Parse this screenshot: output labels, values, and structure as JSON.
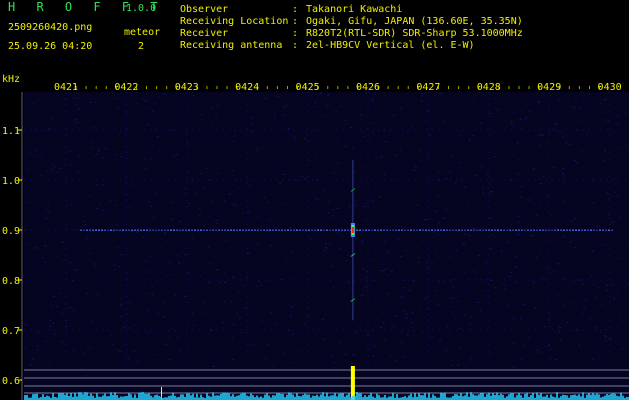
{
  "app": {
    "logo": "H R O F F T",
    "version": "1.0.0",
    "filename": "2509260420.png",
    "datetime": "25.09.26 04:20",
    "mode_label": "meteor",
    "count": "2"
  },
  "info": [
    {
      "label": "Observer",
      "sep": ":",
      "value": "Takanori Kawachi"
    },
    {
      "label": "Receiving Location",
      "sep": ":",
      "value": "Ogaki, Gifu, JAPAN (136.60E, 35.35N)"
    },
    {
      "label": "Receiver",
      "sep": ":",
      "value": "R820T2(RTL-SDR) SDR-Sharp 53.1000MHz"
    },
    {
      "label": "Receiving antenna",
      "sep": ":",
      "value": "2el-HB9CV Vertical (el. E-W)"
    }
  ],
  "chart_data": {
    "type": "heatmap",
    "ylabel": "kHz",
    "x_ticks": [
      "0421",
      "0422",
      "0423",
      "0424",
      "0425",
      "0426",
      "0427",
      "0428",
      "0429",
      "0430"
    ],
    "y_ticks": [
      "1.1",
      "1.0",
      "0.9",
      "0.8",
      "0.7",
      "0.6"
    ],
    "ylim": [
      0.6,
      1.1
    ],
    "carrier_frequency_khz": 0.9,
    "events": [
      {
        "time": "04:25:45",
        "freq_center_khz": 0.9,
        "freq_span_khz": [
          0.72,
          1.04
        ],
        "label": "meteor echo"
      }
    ],
    "colors": {
      "background": "#050522",
      "noise": "#1a1a7a",
      "carrier": "#5a78ff",
      "echo_core": "#ff2020",
      "echo_mid": "#30ff60",
      "axis_text": "#f0f000",
      "grid": "#a0a0c8",
      "level_meter": "#20d0ff",
      "marker": "#ffff00"
    }
  }
}
